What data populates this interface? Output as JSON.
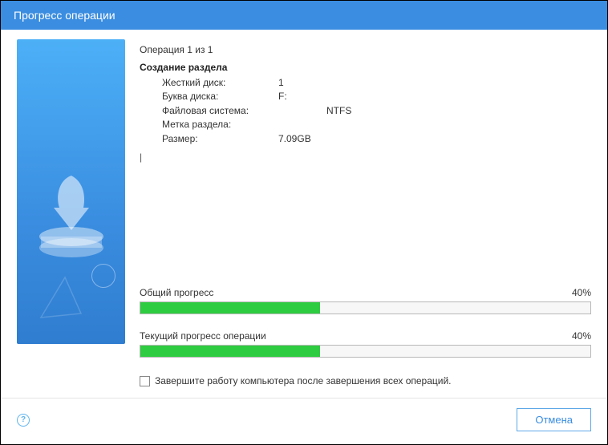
{
  "window": {
    "title": "Прогресс операции"
  },
  "operation": {
    "counter": "Операция 1 из 1",
    "heading": "Создание раздела",
    "details": {
      "disk_label": "Жесткий диск:",
      "disk_value": "1",
      "letter_label": "Буква диска:",
      "letter_value": "F:",
      "fs_label": "Файловая система:",
      "fs_value": "NTFS",
      "volume_label": "Метка раздела:",
      "volume_value": "",
      "size_label": "Размер:",
      "size_value": "7.09GB"
    }
  },
  "progress": {
    "overall_label": "Общий прогресс",
    "overall_pct_text": "40%",
    "overall_pct": 40,
    "current_label": "Текущий прогресс операции",
    "current_pct_text": "40%",
    "current_pct": 40
  },
  "shutdown_checkbox": {
    "label": "Завершите работу компьютера после завершения всех операций."
  },
  "footer": {
    "help": "?",
    "cancel_label": "Отмена"
  }
}
